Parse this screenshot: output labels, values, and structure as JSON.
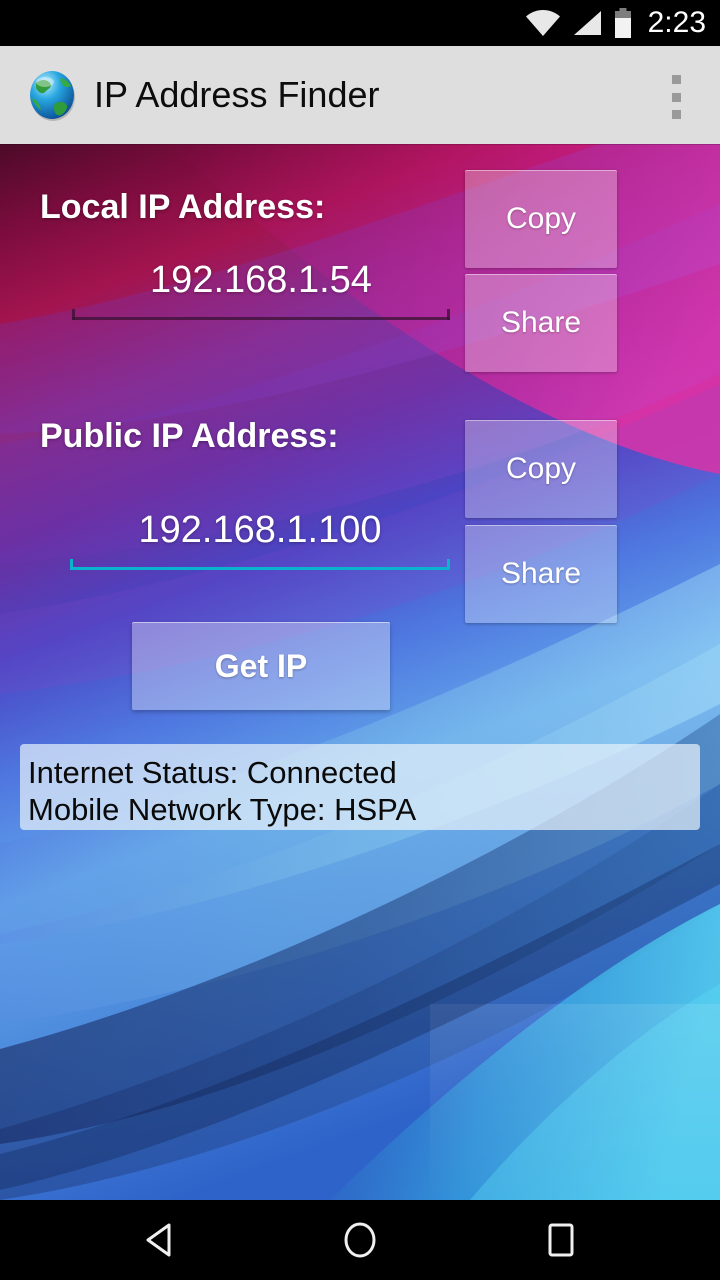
{
  "status_bar": {
    "time": "2:23",
    "icons": [
      "wifi-icon",
      "cellular-signal-icon",
      "battery-icon"
    ]
  },
  "action_bar": {
    "app_icon": "globe-icon",
    "title": "IP Address Finder",
    "overflow_menu": "overflow-menu-icon"
  },
  "local": {
    "label": "Local IP Address:",
    "value": "192.168.1.54",
    "copy_label": "Copy",
    "share_label": "Share",
    "underline_color": "#3a1133"
  },
  "public": {
    "label": "Public IP Address:",
    "value": "192.168.1.100",
    "copy_label": "Copy",
    "share_label": "Share",
    "underline_color": "#0ab4cf"
  },
  "get_ip": {
    "label": "Get IP"
  },
  "status_panel": {
    "line1": "Internet Status: Connected",
    "line2": "Mobile Network Type: HSPA"
  },
  "nav_bar": {
    "back": "back-triangle-icon",
    "home": "home-circle-icon",
    "recent": "recents-square-icon"
  },
  "theme": {
    "action_bar_bg": "#dedede",
    "accent": "#0ab4cf",
    "text_light": "#ffffff",
    "text_dark": "#0a0a0a",
    "system_bar_bg": "#000000"
  }
}
